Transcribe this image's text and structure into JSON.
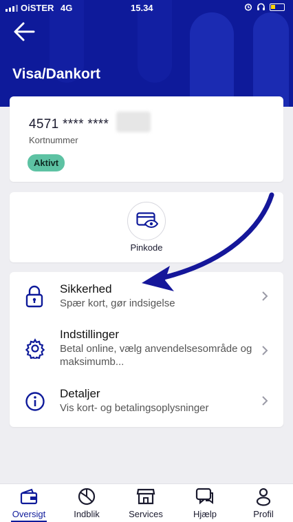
{
  "status_bar": {
    "carrier": "OiSTER",
    "network": "4G",
    "time": "15.34"
  },
  "header": {
    "title": "Visa/Dankort"
  },
  "card": {
    "number": "4571 **** ****",
    "number_label": "Kortnummer",
    "status": "Aktivt",
    "status_color": "#5dc2a3"
  },
  "pin": {
    "label": "Pinkode"
  },
  "menu": [
    {
      "title": "Sikkerhed",
      "subtitle": "Spær kort, gør indsigelse",
      "icon": "lock-icon"
    },
    {
      "title": "Indstillinger",
      "subtitle": "Betal online, vælg anvendelsesområde og maksimumb...",
      "icon": "gear-icon"
    },
    {
      "title": "Detaljer",
      "subtitle": "Vis kort- og betalingsoplysninger",
      "icon": "info-icon"
    }
  ],
  "tabs": [
    {
      "label": "Oversigt",
      "icon": "wallet-icon",
      "active": true
    },
    {
      "label": "Indblik",
      "icon": "pie-chart-icon",
      "active": false
    },
    {
      "label": "Services",
      "icon": "store-icon",
      "active": false
    },
    {
      "label": "Hjælp",
      "icon": "chat-icon",
      "active": false
    },
    {
      "label": "Profil",
      "icon": "person-icon",
      "active": false
    }
  ],
  "colors": {
    "brand": "#0e1a9a",
    "accent": "#1b2bb2",
    "annotation_arrow": "#15179a"
  }
}
